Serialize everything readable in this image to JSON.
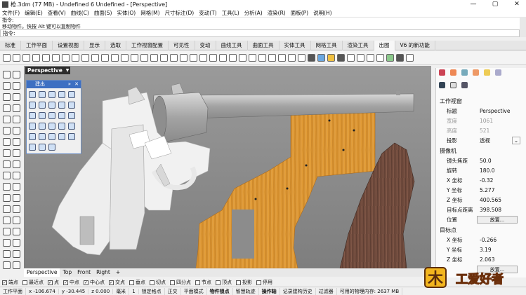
{
  "window": {
    "title": "枪.3dm (77 MB) - Undefined 6 Undefined - [Perspective]"
  },
  "menu": [
    "文件(F)",
    "编辑(E)",
    "查看(V)",
    "曲线(C)",
    "曲面(S)",
    "实体(O)",
    "网格(M)",
    "尺寸标注(D)",
    "变动(T)",
    "工具(L)",
    "分析(A)",
    "渲染(R)",
    "面板(P)",
    "说明(H)"
  ],
  "command": {
    "history": [
      "指令:",
      "移动物件。快按 Alt 键可以复制物件"
    ],
    "prompt": "指令:"
  },
  "tabs": [
    "标准",
    "工作平面",
    "设置视图",
    "显示",
    "选取",
    "工作视窗配置",
    "可见性",
    "变动",
    "曲线工具",
    "曲面工具",
    "实体工具",
    "网格工具",
    "渲染工具",
    "出图",
    "V6 的新功能"
  ],
  "active_tab": "出图",
  "viewport": {
    "title": "Perspective",
    "palette_title": "建出",
    "view_tabs": [
      "Perspective",
      "Top",
      "Front",
      "Right"
    ],
    "add_tab": "+"
  },
  "osnap": [
    {
      "label": "端点",
      "checked": true
    },
    {
      "label": "最近点",
      "checked": false
    },
    {
      "label": "点",
      "checked": true
    },
    {
      "label": "中点",
      "checked": true
    },
    {
      "label": "中心点",
      "checked": true
    },
    {
      "label": "交点",
      "checked": true
    },
    {
      "label": "垂点",
      "checked": false
    },
    {
      "label": "切点",
      "checked": false
    },
    {
      "label": "四分点",
      "checked": false
    },
    {
      "label": "节点",
      "checked": false
    },
    {
      "label": "顶点",
      "checked": false
    },
    {
      "label": "投影",
      "checked": false
    },
    {
      "label": "停用",
      "checked": false
    }
  ],
  "status": {
    "plane": "工作平面",
    "x": "x -106.674",
    "y": "y -30.445",
    "z": "z 0.000",
    "unit": "毫米",
    "layer": "1",
    "items": [
      "锁定格点",
      "正交",
      "平面模式",
      "物件锁点",
      "智慧轨迹",
      "操作轴",
      "记录建构历史",
      "过滤器"
    ],
    "memory": "可用的物理内存: 2637 MB"
  },
  "properties": {
    "section_view": "工作视窗",
    "rows": [
      {
        "k": "标题",
        "v": "Perspective",
        "dim": false
      },
      {
        "k": "宽度",
        "v": "1061",
        "dim": true
      },
      {
        "k": "高度",
        "v": "521",
        "dim": true
      },
      {
        "k": "投影",
        "v": "透视",
        "dim": false
      }
    ],
    "section_camera": "摄像机",
    "camera": [
      {
        "k": "镜头焦距",
        "v": "50.0"
      },
      {
        "k": "旋转",
        "v": "180.0"
      },
      {
        "k": "X 坐标",
        "v": "-0.32"
      },
      {
        "k": "Y 坐标",
        "v": "5.277"
      },
      {
        "k": "Z 坐标",
        "v": "400.565"
      },
      {
        "k": "目标点距离",
        "v": "398.508"
      }
    ],
    "position_label": "位置",
    "place_button": "放置...",
    "section_target": "目标点",
    "target": [
      {
        "k": "X 坐标",
        "v": "-0.266"
      },
      {
        "k": "Y 坐标",
        "v": "3.19"
      },
      {
        "k": "Z 坐标",
        "v": "2.063"
      }
    ],
    "place_button2": "放置..."
  },
  "watermark": "木工爱好者",
  "colors": {
    "viewport_bg": "#8c8c8c",
    "wood_light": "#d9922f",
    "wood_dark": "#6f4a3c",
    "metal": "#b7b7b7",
    "accent_blue": "#3d6fc2"
  }
}
